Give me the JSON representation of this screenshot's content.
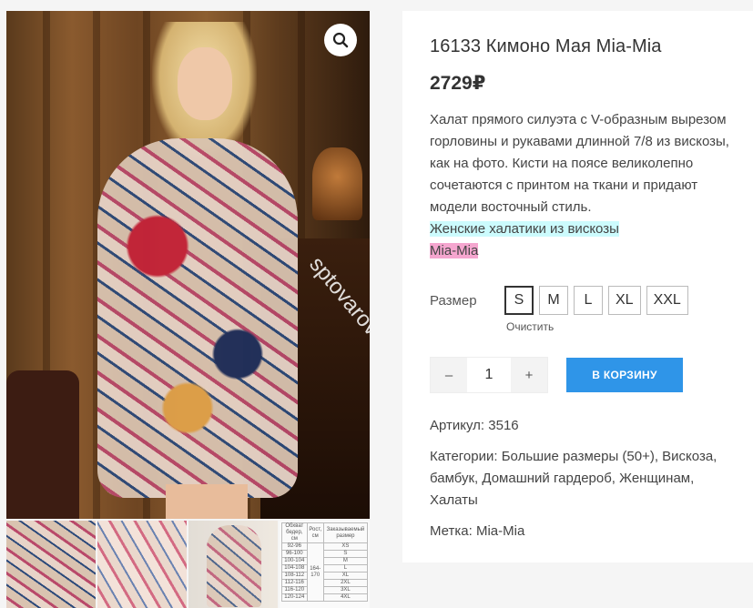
{
  "product": {
    "title": "16133 Кимоно Мая Mia-Mia",
    "price": "2729₽",
    "description": "Халат прямого силуэта с V-образным вырезом горловины и рукавами длинной 7/8 из вискозы, как на фото. Кисти на поясе великолепно сочетаются с принтом на ткани и придают модели восточный стиль.",
    "highlight_link_1": "Женские халатики из вискозы",
    "highlight_link_2": "Mia-Mia"
  },
  "variations": {
    "size_label": "Размер",
    "sizes": [
      "S",
      "M",
      "L",
      "XL",
      "XXL"
    ],
    "selected": "S",
    "clear_label": "Очистить"
  },
  "cart": {
    "minus_label": "–",
    "plus_label": "+",
    "quantity": "1",
    "add_to_cart_label": "В КОРЗИНУ"
  },
  "meta": {
    "sku_text": "Артикул: 3516",
    "categories_text": "Категории: Большие размеры (50+), Вискоза, бамбук, Домашний гардероб, Женщинам, Халаты",
    "tag_text": "Метка: Mia-Mia"
  },
  "gallery": {
    "watermark": "sptovarov.ru",
    "zoom_icon": "search-icon",
    "size_chart": {
      "headers": [
        "Обхват бедер, см",
        "Рост, см",
        "Заказываемый размер"
      ],
      "rows": [
        [
          "92-96",
          "XS"
        ],
        [
          "96-100",
          "S"
        ],
        [
          "100-104",
          "M"
        ],
        [
          "104-108",
          "L"
        ],
        [
          "108-112",
          "XL"
        ],
        [
          "112-116",
          "2XL"
        ],
        [
          "116-120",
          "3XL"
        ],
        [
          "120-124",
          "4XL"
        ]
      ],
      "height": "164-170"
    }
  },
  "colors": {
    "accent": "#2f95e8",
    "highlight_cyan": "#ccfbfd",
    "highlight_pink": "#f5a6cf"
  }
}
